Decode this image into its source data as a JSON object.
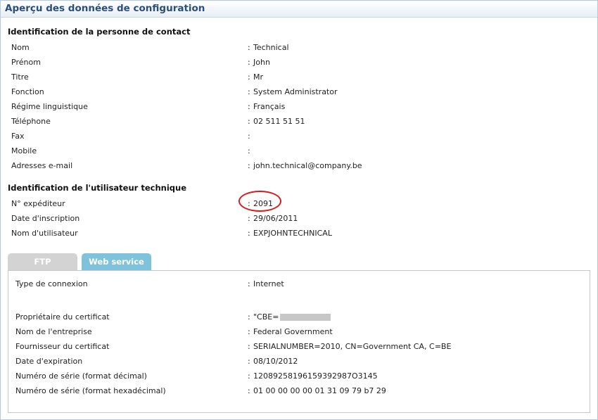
{
  "panel": {
    "title": "Aperçu des données de configuration"
  },
  "contact": {
    "title": "Identification de la personne de contact",
    "rows": [
      {
        "label": "Nom",
        "value": "Technical"
      },
      {
        "label": "Prénom",
        "value": "John"
      },
      {
        "label": "Titre",
        "value": "Mr"
      },
      {
        "label": "Fonction",
        "value": "System Administrator"
      },
      {
        "label": "Régime linguistique",
        "value": "Français"
      },
      {
        "label": "Téléphone",
        "value": "02 511 51 51"
      },
      {
        "label": "Fax",
        "value": ""
      },
      {
        "label": "Mobile",
        "value": ""
      },
      {
        "label": "Adresses e-mail",
        "value": "john.technical@company.be"
      }
    ]
  },
  "technical": {
    "title": "Identification de l'utilisateur technique",
    "rows": [
      {
        "label": "N° expéditeur",
        "value": "2091"
      },
      {
        "label": "Date d'inscription",
        "value": "29/06/2011"
      },
      {
        "label": "Nom d'utilisateur",
        "value": "EXPJOHNTECHNICAL"
      }
    ]
  },
  "tabs": {
    "ftp": "FTP",
    "webservice": "Web service"
  },
  "webservice": {
    "connection": {
      "label": "Type de connexion",
      "value": "Internet"
    },
    "rows": [
      {
        "label": "Propriétaire du certificat",
        "value": "\"CBE="
      },
      {
        "label": "Nom de l'entreprise",
        "value": "Federal Government"
      },
      {
        "label": "Fournisseur du certificat",
        "value": "SERIALNUMBER=2010, CN=Government CA, C=BE"
      },
      {
        "label": "Date d'expiration",
        "value": "08/10/2012"
      },
      {
        "label": "Numéro de série (format décimal)",
        "value": "12089258196159392987O3145"
      },
      {
        "label": "Numéro de série (format hexadécimal)",
        "value": "01 00 00 00 00 01 31 09 79 b7 29"
      }
    ]
  },
  "separator": ":"
}
